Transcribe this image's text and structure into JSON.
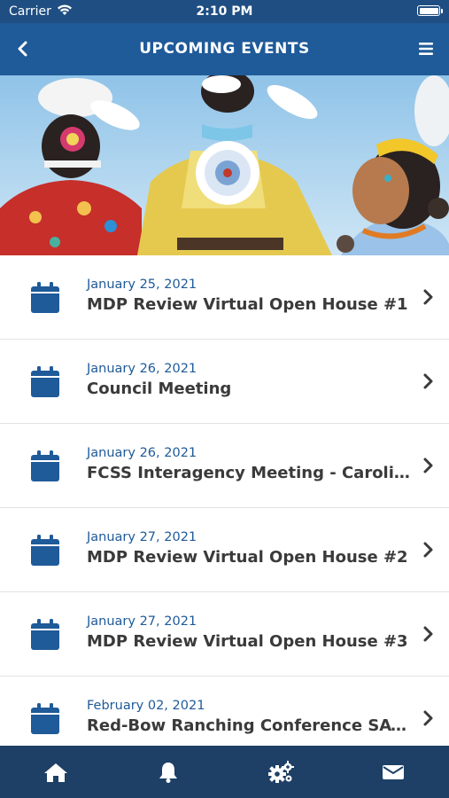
{
  "status_bar": {
    "carrier": "Carrier",
    "time": "2:10 PM"
  },
  "nav": {
    "title": "UPCOMING EVENTS"
  },
  "colors": {
    "nav": "#1f5a99",
    "status_bar": "#1f4e82",
    "tab_bar": "#1e3f66",
    "accent": "#1f5a99"
  },
  "events": [
    {
      "date": "January 25, 2021",
      "title": "MDP Review Virtual Open House #1"
    },
    {
      "date": "January 26, 2021",
      "title": "Council Meeting"
    },
    {
      "date": "January 26, 2021",
      "title": "FCSS Interagency Meeting - Caroline"
    },
    {
      "date": "January 27, 2021",
      "title": "MDP Review Virtual Open House #2"
    },
    {
      "date": "January 27, 2021",
      "title": "MDP Review Virtual Open House #3"
    },
    {
      "date": "February 02, 2021",
      "title": "Red-Bow Ranching Conference SAVE T..."
    }
  ],
  "tabs": [
    {
      "icon": "home-icon"
    },
    {
      "icon": "bell-icon"
    },
    {
      "icon": "gears-icon"
    },
    {
      "icon": "envelope-icon"
    }
  ]
}
